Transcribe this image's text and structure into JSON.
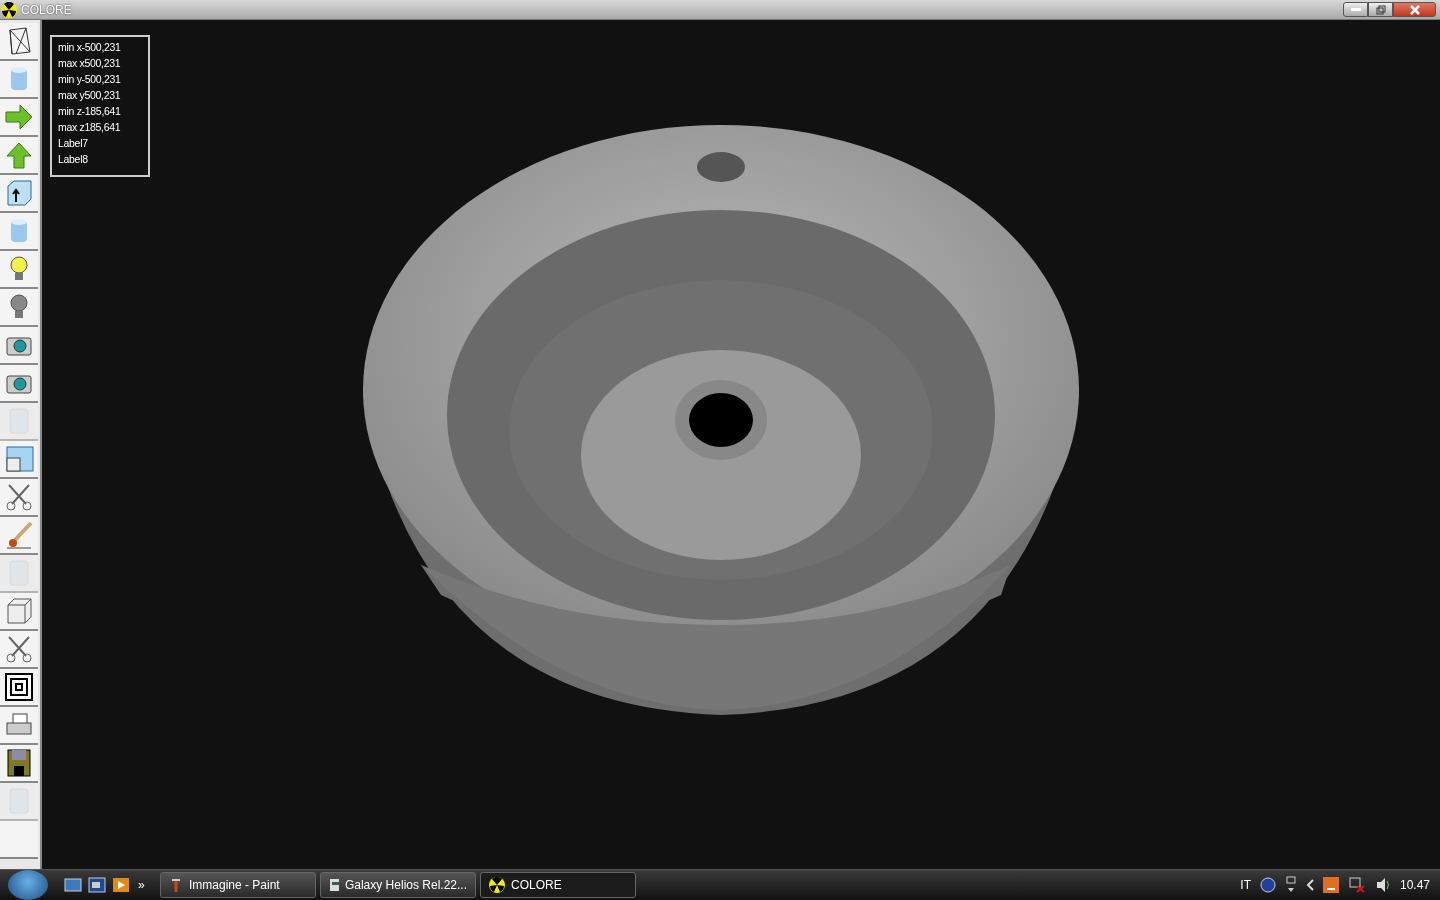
{
  "window": {
    "title": "COLORE"
  },
  "toolbar": [
    {
      "kind": "wireframe",
      "disabled": false
    },
    {
      "kind": "cylinder",
      "disabled": false
    },
    {
      "kind": "arrow-right",
      "disabled": false
    },
    {
      "kind": "arrow-up",
      "disabled": false
    },
    {
      "kind": "box-arrow",
      "disabled": false
    },
    {
      "kind": "cylinder",
      "disabled": false
    },
    {
      "kind": "bulb-on",
      "disabled": false
    },
    {
      "kind": "bulb-off",
      "disabled": false
    },
    {
      "kind": "camera",
      "disabled": false
    },
    {
      "kind": "camera",
      "disabled": false
    },
    {
      "kind": "texture",
      "disabled": true
    },
    {
      "kind": "split",
      "disabled": false
    },
    {
      "kind": "scissors",
      "disabled": false
    },
    {
      "kind": "brush",
      "disabled": false
    },
    {
      "kind": "texture",
      "disabled": true
    },
    {
      "kind": "cube",
      "disabled": false
    },
    {
      "kind": "scissors",
      "disabled": false
    },
    {
      "kind": "squares",
      "disabled": false
    },
    {
      "kind": "printer",
      "disabled": false
    },
    {
      "kind": "floppy",
      "disabled": false
    },
    {
      "kind": "texture",
      "disabled": true
    },
    {
      "kind": "blank",
      "disabled": false
    }
  ],
  "info_labels": [
    "min x-500,231",
    "max x500,231",
    "min y-500,231",
    "max y500,231",
    "min z-185,641",
    "max z185,641",
    "Label7",
    "Label8"
  ],
  "taskbar": {
    "tasks": [
      {
        "label": "Immagine - Paint",
        "kind": "paint",
        "selected": false
      },
      {
        "label": "Galaxy Helios  Rel.22...",
        "kind": "doc",
        "selected": false
      },
      {
        "label": "COLORE",
        "kind": "colore",
        "selected": true
      }
    ],
    "overflow": "»",
    "language": "IT",
    "clock": "10.47"
  }
}
